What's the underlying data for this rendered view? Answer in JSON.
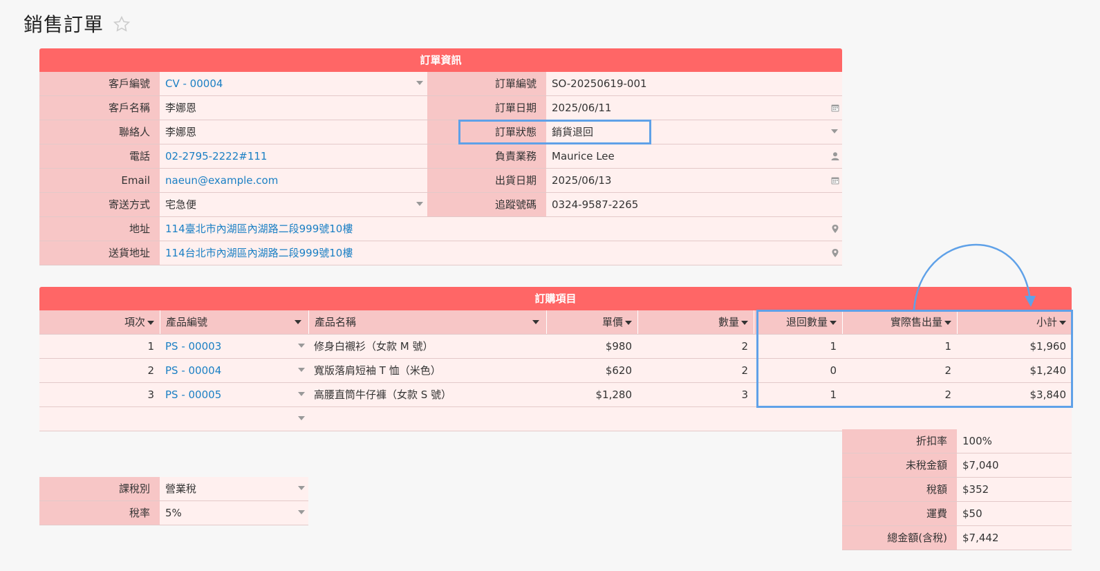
{
  "page": {
    "title": "銷售訂單"
  },
  "order_info": {
    "header": "訂單資訊",
    "left": [
      {
        "label": "客戶編號",
        "value": "CV - 00004",
        "link": true,
        "dropdown": true
      },
      {
        "label": "客戶名稱",
        "value": "李娜恩"
      },
      {
        "label": "聯絡人",
        "value": "李娜恩"
      },
      {
        "label": "電話",
        "value": "02-2795-2222#111",
        "link": true
      },
      {
        "label": "Email",
        "value": "naeun@example.com",
        "link": true
      },
      {
        "label": "寄送方式",
        "value": "宅急便",
        "dropdown": true
      }
    ],
    "right": [
      {
        "label": "訂單編號",
        "value": "SO-20250619-001"
      },
      {
        "label": "訂單日期",
        "value": "2025/06/11",
        "icon": "calendar-icon"
      },
      {
        "label": "訂單狀態",
        "value": "銷貨退回",
        "dropdown": true
      },
      {
        "label": "負責業務",
        "value": "Maurice Lee",
        "icon": "person-icon"
      },
      {
        "label": "出貨日期",
        "value": "2025/06/13",
        "icon": "calendar-icon"
      },
      {
        "label": "追蹤號碼",
        "value": "0324-9587-2265"
      }
    ],
    "full": [
      {
        "label": "地址",
        "value": "114臺北市內湖區內湖路二段999號10樓",
        "icon": "map-pin-icon"
      },
      {
        "label": "送貨地址",
        "value": "114台北市內湖區內湖路二段999號10樓",
        "icon": "map-pin-icon"
      }
    ]
  },
  "items": {
    "header": "訂購項目",
    "columns": [
      "項次",
      "產品編號",
      "產品名稱",
      "單價",
      "數量",
      "退回數量",
      "實際售出量",
      "小計"
    ],
    "rows": [
      {
        "no": "1",
        "code": "PS - 00003",
        "name": "修身白襯衫（女款 M 號）",
        "price": "$980",
        "qty": "2",
        "ret": "1",
        "sold": "1",
        "sub": "$1,960"
      },
      {
        "no": "2",
        "code": "PS - 00004",
        "name": "寬版落肩短袖 T 恤（米色）",
        "price": "$620",
        "qty": "2",
        "ret": "0",
        "sold": "2",
        "sub": "$1,240"
      },
      {
        "no": "3",
        "code": "PS - 00005",
        "name": "高腰直筒牛仔褲（女款 S 號）",
        "price": "$1,280",
        "qty": "3",
        "ret": "1",
        "sold": "2",
        "sub": "$3,840"
      }
    ]
  },
  "tax": [
    {
      "label": "課稅別",
      "value": "營業稅"
    },
    {
      "label": "稅率",
      "value": "5%"
    }
  ],
  "totals": [
    {
      "label": "折扣率",
      "value": "100%"
    },
    {
      "label": "未稅金額",
      "value": "$7,040"
    },
    {
      "label": "稅額",
      "value": "$352"
    },
    {
      "label": "運費",
      "value": "$50"
    },
    {
      "label": "總金額(含稅)",
      "value": "$7,442"
    }
  ],
  "colors": {
    "band": "#ff6666",
    "label_bg": "#f7c6c6",
    "value_bg": "#fff0ef",
    "link": "#1a7fc4",
    "highlight": "#5fa1e8"
  }
}
